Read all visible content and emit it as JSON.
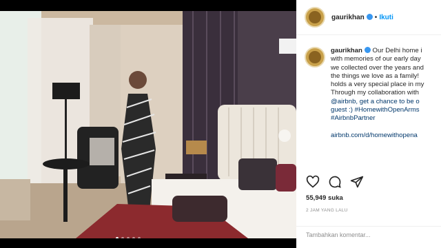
{
  "post": {
    "username": "gaurikhan",
    "follow_label": "Ikuti",
    "caption_lines": [
      "Our Delhi home i",
      "with memories of our early day",
      "we collected over the years and",
      "the things we love as a family!",
      "holds a very special place in my",
      "Through my collaboration with",
      "@airbnb, get a chance to be o",
      "guest :) #HomewithOpenArms",
      "#AirbnbPartner"
    ],
    "link_text": "airbnb.com/d/homewithopena",
    "likes": "55,949 suka",
    "timestamp": "2 JAM YANG LALU",
    "comment_placeholder": "Tambahkan komentar...",
    "carousel_index": 1,
    "carousel_count": 5
  },
  "icons": [
    "heart-icon",
    "comment-icon",
    "share-icon",
    "verified-icon",
    "next-arrow-icon"
  ],
  "colors": {
    "verified": "#3897f0",
    "follow": "#0095f6",
    "link": "#00376b"
  }
}
